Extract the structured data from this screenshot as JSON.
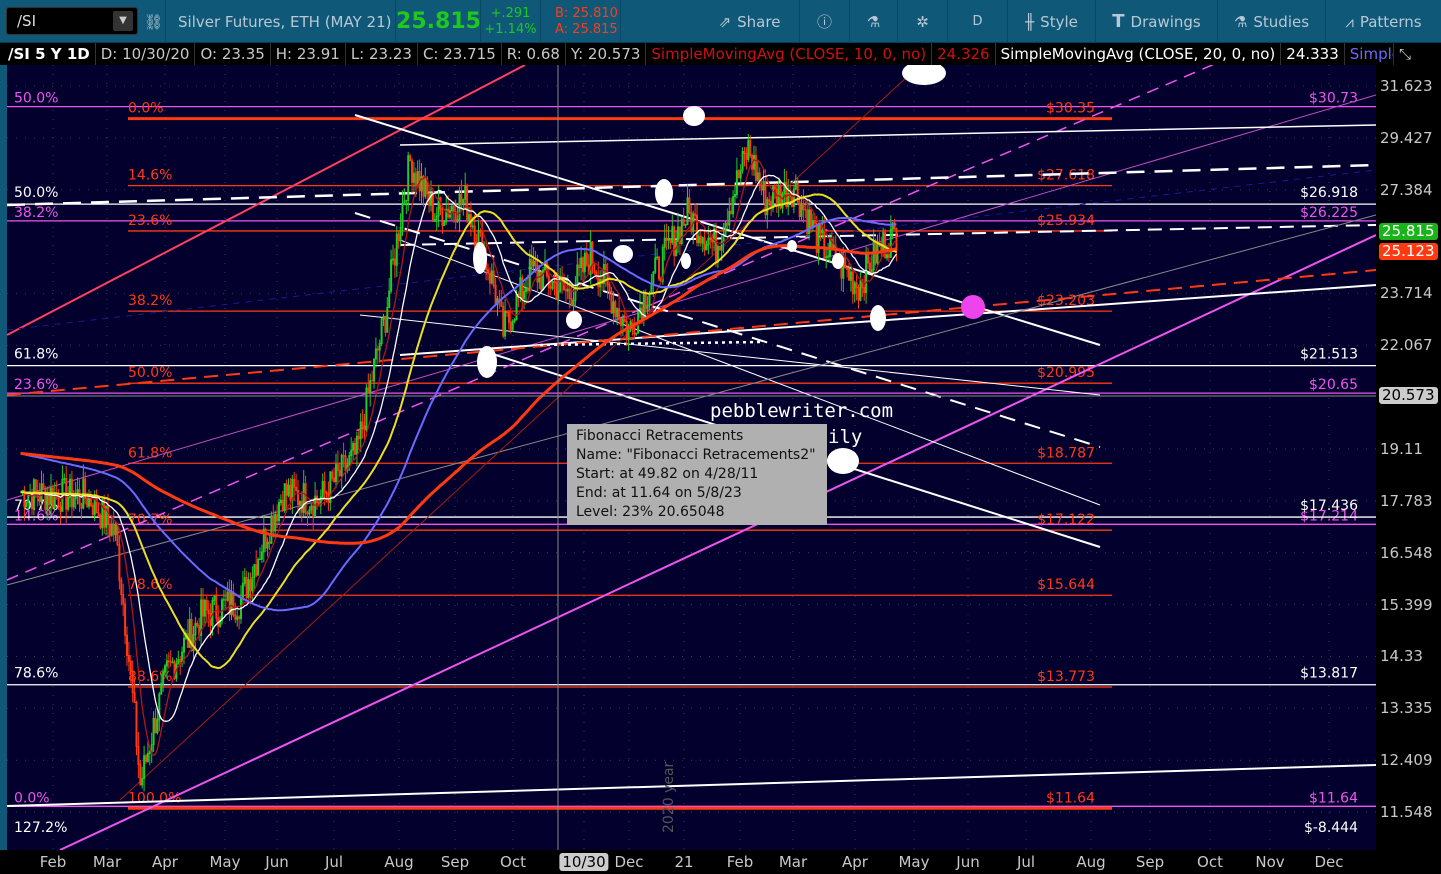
{
  "toolbar": {
    "symbol": "/SI",
    "description": "Silver Futures, ETH (MAY 21)",
    "last": "25.815",
    "change": "+.291",
    "change_pct": "+1.14%",
    "bid": "B: 25.810",
    "ask": "A: 25.815",
    "share_label": "Share",
    "aggregation_label": "D",
    "style_label": "Style",
    "drawings_label": "Drawings",
    "studies_label": "Studies",
    "patterns_label": "Patterns",
    "colors": {
      "bg": "#0f5878",
      "last": "#1ec81e",
      "change": "#1ec81e",
      "bidask": "#ff3b1a"
    }
  },
  "infobar": {
    "title": "/SI 5 Y 1D",
    "date": "D: 10/30/20",
    "open": "O: 23.35",
    "high": "H: 23.91",
    "low": "L: 23.23",
    "close": "C: 23.715",
    "range": "R: 0.68",
    "y": "Y: 20.573",
    "sma10_label": "SimpleMovingAvg (CLOSE, 10, 0, no)",
    "sma10_value": "24.326",
    "sma20_label": "SimpleMovingAvg (CLOSE, 20, 0, no)",
    "sma20_value": "24.333",
    "more_label": "Simple..."
  },
  "price_axis": {
    "ticks": [
      "31.623",
      "29.427",
      "27.384",
      "23.714",
      "22.067",
      "19.11",
      "17.783",
      "16.548",
      "15.399",
      "14.33",
      "13.335",
      "12.409",
      "11.548"
    ],
    "last_tag": "25.815",
    "sma_tag": "25.123",
    "cursor_tag": "20.573",
    "scale": "log"
  },
  "time_axis": {
    "labels": [
      "Feb",
      "Mar",
      "Apr",
      "May",
      "Jun",
      "Jul",
      "Aug",
      "Sep",
      "Oct",
      "10/30",
      "Dec",
      "21",
      "Feb",
      "Mar",
      "Apr",
      "May",
      "Jun",
      "Jul",
      "Aug",
      "Sep",
      "Oct",
      "Nov",
      "Dec"
    ],
    "year_marker": "2020 year"
  },
  "fib_orange": [
    {
      "pct": "0.0%",
      "price": "$30.35",
      "value": 30.35
    },
    {
      "pct": "14.6%",
      "price": "$27.618",
      "value": 27.618
    },
    {
      "pct": "23.6%",
      "price": "$25.934",
      "value": 25.934
    },
    {
      "pct": "38.2%",
      "price": "$23.203",
      "value": 23.203
    },
    {
      "pct": "50.0%",
      "price": "$20.995",
      "value": 20.995
    },
    {
      "pct": "61.8%",
      "price": "$18.787",
      "value": 18.787
    },
    {
      "pct": "70.7%",
      "price": "$17.122",
      "value": 17.122
    },
    {
      "pct": "78.6%",
      "price": "$15.644",
      "value": 15.644
    },
    {
      "pct": "88.6%",
      "price": "$13.773",
      "value": 13.773
    },
    {
      "pct": "100.0%",
      "price": "$11.64",
      "value": 11.64
    }
  ],
  "fib_magenta": [
    {
      "pct": "50.0%",
      "price": "$30.73",
      "value": 30.73
    },
    {
      "pct": "38.2%",
      "price": "$26.225",
      "value": 26.225
    },
    {
      "pct": "23.6%",
      "price": "$20.65",
      "value": 20.65
    },
    {
      "pct": "14.6%",
      "price": "$17.214",
      "value": 17.214
    },
    {
      "pct": "0.0%",
      "price": "$11.64",
      "value": 11.64
    }
  ],
  "fib_white": [
    {
      "pct": "50.0%",
      "price": "$26.918",
      "value": 26.918
    },
    {
      "pct": "61.8%",
      "price": "$21.513",
      "value": 21.513
    },
    {
      "pct": "70.7%",
      "price": "$17.436",
      "value": 17.436
    },
    {
      "pct": "78.6%",
      "price": "$13.817",
      "value": 13.817
    },
    {
      "pct": "127.2%",
      "price": "$-8.444",
      "value": -8.444
    }
  ],
  "tooltip": {
    "title": "Fibonacci Retracements",
    "name": "Name: \"Fibonacci Retracements2\"",
    "start": "Start: at 49.82 on 4/28/11",
    "end": "End: at 11.64 on 5/8/23",
    "level": "Level: 23% 20.65048"
  },
  "watermark": {
    "line1": "pebblewriter.com",
    "line2": "ily"
  },
  "chart_data": {
    "type": "candlestick",
    "symbol": "/SI",
    "aggregation": "1D",
    "yscale": "log",
    "ylim": [
      11.2,
      32.5
    ],
    "price_approx": [
      [
        "2020-01-15",
        18.0
      ],
      [
        "2020-02-20",
        17.9
      ],
      [
        "2020-03-05",
        17.0
      ],
      [
        "2020-03-18",
        12.0
      ],
      [
        "2020-04-01",
        14.0
      ],
      [
        "2020-04-20",
        15.2
      ],
      [
        "2020-05-10",
        15.5
      ],
      [
        "2020-06-01",
        18.0
      ],
      [
        "2020-06-20",
        17.8
      ],
      [
        "2020-07-10",
        19.0
      ],
      [
        "2020-07-25",
        23.0
      ],
      [
        "2020-08-07",
        28.5
      ],
      [
        "2020-08-20",
        26.5
      ],
      [
        "2020-09-05",
        27.0
      ],
      [
        "2020-09-20",
        24.0
      ],
      [
        "2020-09-25",
        22.5
      ],
      [
        "2020-10-10",
        24.5
      ],
      [
        "2020-10-30",
        23.7
      ],
      [
        "2020-11-10",
        25.0
      ],
      [
        "2020-11-30",
        22.5
      ],
      [
        "2020-12-15",
        24.5
      ],
      [
        "2020-12-31",
        26.5
      ],
      [
        "2021-01-15",
        25.3
      ],
      [
        "2021-02-01",
        29.0
      ],
      [
        "2021-02-10",
        27.0
      ],
      [
        "2021-02-25",
        27.5
      ],
      [
        "2021-03-10",
        25.5
      ],
      [
        "2021-03-31",
        24.0
      ],
      [
        "2021-04-10",
        25.2
      ],
      [
        "2021-04-20",
        25.815
      ]
    ],
    "studies": [
      {
        "name": "SimpleMovingAvg (CLOSE, 10, 0, no)",
        "length": 10,
        "color": "#b01818"
      },
      {
        "name": "SimpleMovingAvg (CLOSE, 20, 0, no)",
        "length": 20,
        "color": "#ffffff"
      },
      {
        "length": 50,
        "color": "#e8e020"
      },
      {
        "length": 100,
        "color": "#6a6aff"
      },
      {
        "length": 200,
        "color": "#ff3a10"
      }
    ],
    "colors": {
      "up": "#22cc22",
      "down": "#ff3a10",
      "background": "#03002e",
      "fib_orange": "#ff3a10",
      "fib_magenta": "#ee55ee",
      "fib_white": "#ffffff"
    }
  }
}
